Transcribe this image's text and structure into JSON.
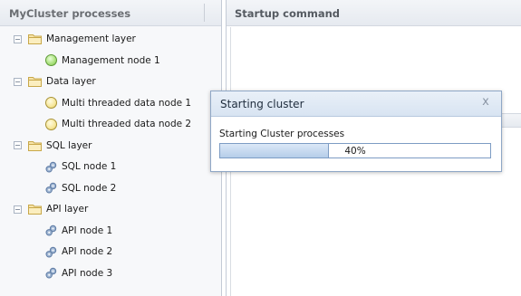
{
  "left_panel": {
    "title": "MyCluster processes",
    "groups": [
      {
        "label": "Management layer",
        "nodes": [
          {
            "label": "Management node 1",
            "icon": "green-status-circle-icon",
            "status_color": "#a8e07a"
          }
        ]
      },
      {
        "label": "Data layer",
        "nodes": [
          {
            "label": "Multi threaded data node 1",
            "icon": "yellow-status-circle-icon",
            "status_color": "#f6e79a"
          },
          {
            "label": "Multi threaded data node 2",
            "icon": "yellow-status-circle-icon",
            "status_color": "#f6e79a"
          }
        ]
      },
      {
        "label": "SQL layer",
        "nodes": [
          {
            "label": "SQL node 1",
            "icon": "gears-icon"
          },
          {
            "label": "SQL node 2",
            "icon": "gears-icon"
          }
        ]
      },
      {
        "label": "API layer",
        "nodes": [
          {
            "label": "API node 1",
            "icon": "gears-icon"
          },
          {
            "label": "API node 2",
            "icon": "gears-icon"
          },
          {
            "label": "API node 3",
            "icon": "gears-icon"
          }
        ]
      }
    ]
  },
  "right_panel": {
    "title": "Startup command"
  },
  "dialog": {
    "title": "Starting cluster",
    "close_icon": "close-icon",
    "close_glyph": "x",
    "message": "Starting Cluster processes",
    "progress_fraction": 0.4,
    "progress_text": "40%"
  },
  "colors": {
    "accent": "#7d9cc4",
    "progress_fill": "#b5cde9"
  }
}
